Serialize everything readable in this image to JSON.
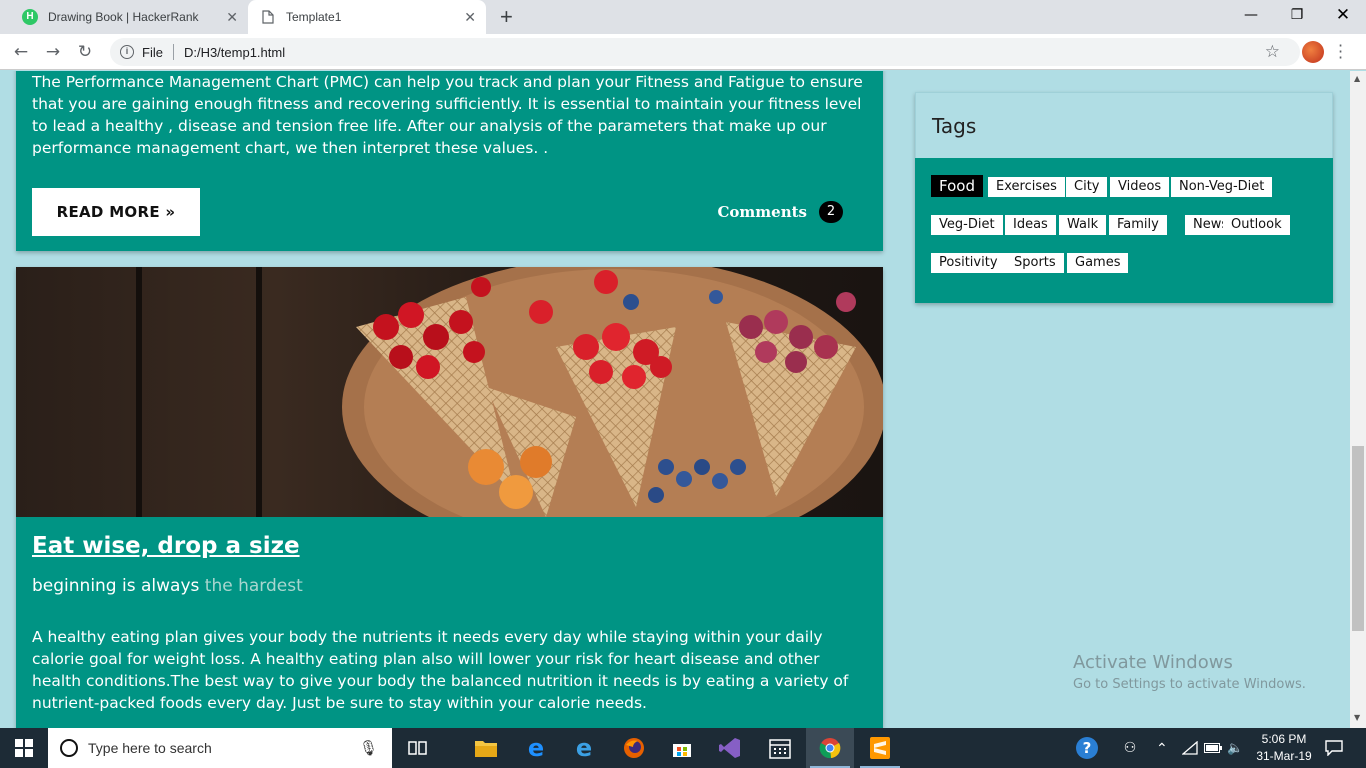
{
  "browser": {
    "tabs": [
      {
        "title": "Drawing Book | HackerRank",
        "favicon": "hackerrank-icon"
      },
      {
        "title": "Template1",
        "favicon": "page-icon"
      }
    ],
    "url_prefix": "File",
    "url": "D:/H3/temp1.html"
  },
  "post1": {
    "text": "The Performance Management Chart (PMC) can help you track and plan your Fitness and Fatigue to ensure that you are gaining enough fitness and recovering sufficiently. It is essential to maintain your fitness level to lead a healthy , disease and tension free life. After our analysis of the parameters that make up our performance management chart, we then interpret these values. .",
    "read_more": "READ MORE »",
    "comments_label": "Comments",
    "comments_count": "2"
  },
  "post2": {
    "title": "Eat wise, drop a size",
    "subtitle_main": "beginning is always ",
    "subtitle_muted": "the hardest",
    "body": "A healthy eating plan gives your body the nutrients it needs every day while staying within your daily calorie goal for weight loss. A healthy eating plan also will lower your risk for heart disease and other health conditions.The best way to give your body the balanced nutrition it needs is by eating a variety of nutrient-packed foods every day. Just be sure to stay within your calorie needs."
  },
  "sidebar": {
    "tags_title": "Tags",
    "tags": [
      "Food",
      "Exercises",
      "City",
      "Videos",
      "Non-Veg-Diet",
      "Veg-Diet",
      "Ideas",
      "Walk",
      "Family",
      "News",
      "Outlook",
      "Positivity",
      "Sports",
      "Games"
    ]
  },
  "watermark": {
    "line1": "Activate Windows",
    "line2": "Go to Settings to activate Windows."
  },
  "taskbar": {
    "search_placeholder": "Type here to search",
    "time": "5:06 PM",
    "date": "31-Mar-19"
  },
  "colors": {
    "teal": "#009484",
    "page_bg": "#b0dde4"
  }
}
